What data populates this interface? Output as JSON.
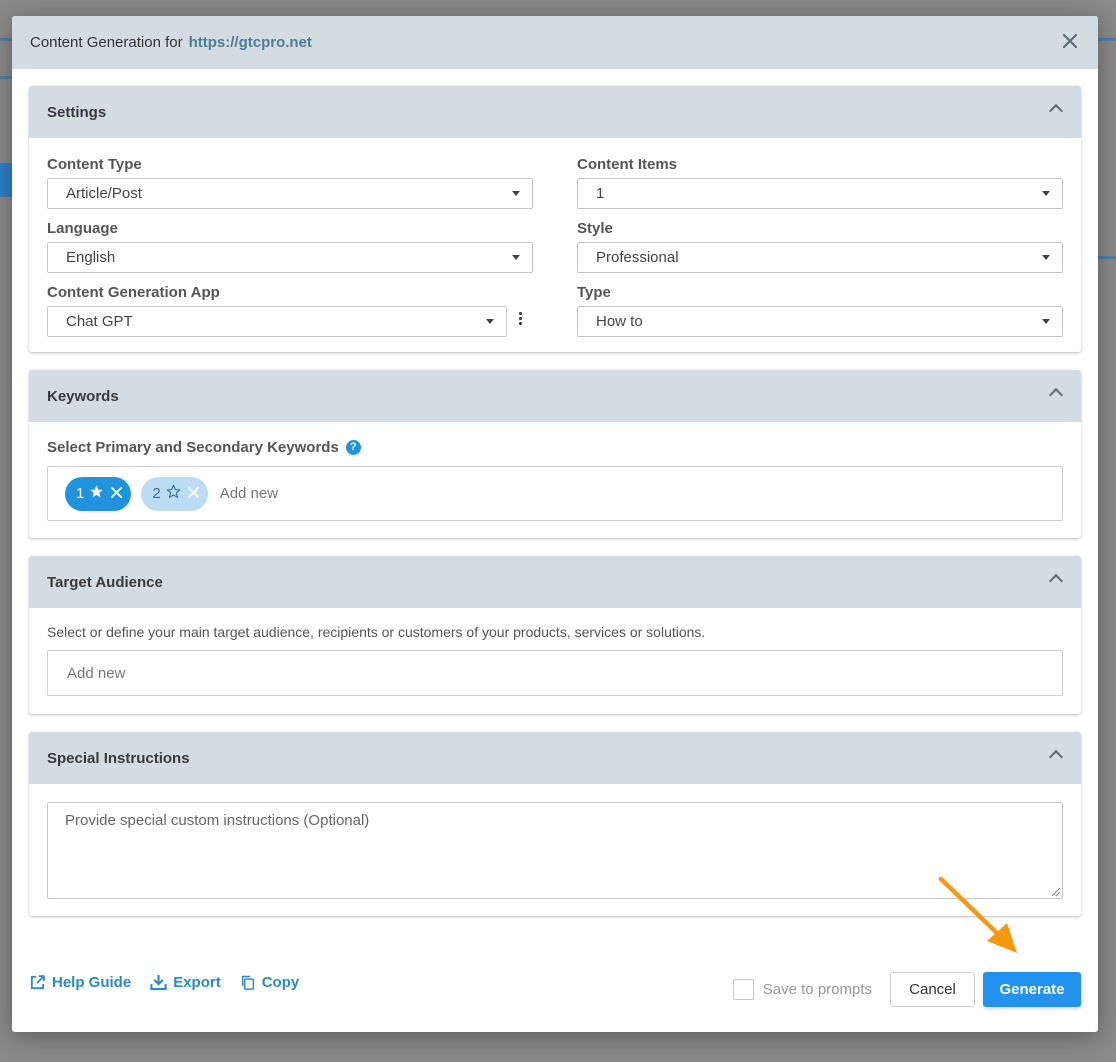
{
  "header": {
    "title": "Content Generation for",
    "url": "https://gtcpro.net"
  },
  "settings": {
    "title": "Settings",
    "content_type": {
      "label": "Content Type",
      "value": "Article/Post"
    },
    "content_items": {
      "label": "Content Items",
      "value": "1"
    },
    "language": {
      "label": "Language",
      "value": "English"
    },
    "style": {
      "label": "Style",
      "value": "Professional"
    },
    "app": {
      "label": "Content Generation App",
      "value": "Chat GPT"
    },
    "type": {
      "label": "Type",
      "value": "How to"
    }
  },
  "keywords": {
    "title": "Keywords",
    "label": "Select Primary and Secondary Keywords",
    "chips": [
      {
        "text": "1",
        "kind": "primary"
      },
      {
        "text": "2",
        "kind": "secondary"
      }
    ],
    "add_new": "Add new"
  },
  "target_audience": {
    "title": "Target Audience",
    "description": "Select or define your main target audience, recipients or customers of your products, services or solutions.",
    "placeholder": "Add new"
  },
  "special_instructions": {
    "title": "Special Instructions",
    "placeholder": "Provide special custom instructions (Optional)"
  },
  "footer": {
    "help_guide": "Help Guide",
    "export": "Export",
    "copy": "Copy",
    "save_to_prompts": "Save to prompts",
    "cancel": "Cancel",
    "generate": "Generate"
  },
  "colors": {
    "accent": "#1f93ef",
    "header_bg": "#d3dce2",
    "link": "#2b89c9",
    "arrow": "#f59a0e"
  }
}
